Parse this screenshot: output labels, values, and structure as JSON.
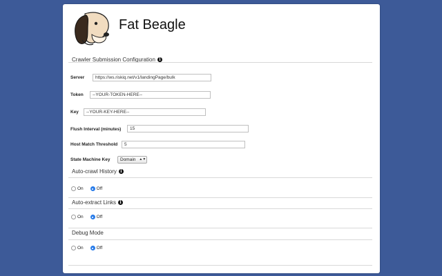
{
  "app": {
    "title": "Fat Beagle"
  },
  "crawler": {
    "legend": "Crawler Submission Configuration",
    "fields": {
      "server": {
        "label": "Server",
        "value": "https://ws.riskiq.net/v1/landingPage/bulk"
      },
      "token": {
        "label": "Token",
        "value": "--YOUR-TOKEN-HERE--"
      },
      "key": {
        "label": "Key",
        "value": "--YOUR-KEY-HERE--"
      },
      "flush_interval": {
        "label": "Flush Interval (minutes)",
        "value": "15"
      },
      "host_match": {
        "label": "Host Match Threshold",
        "value": "5"
      },
      "state_machine_key": {
        "label": "State Machine Key",
        "value": "Domain"
      }
    }
  },
  "auto_crawl": {
    "legend": "Auto-crawl History",
    "on_label": "On",
    "off_label": "Off",
    "selected": "Off"
  },
  "auto_extract": {
    "legend": "Auto-extract Links",
    "on_label": "On",
    "off_label": "Off",
    "selected": "Off"
  },
  "debug": {
    "legend": "Debug Mode",
    "on_label": "On",
    "off_label": "Off",
    "selected": "Off"
  },
  "colors": {
    "background": "#3d5a98",
    "radio_checked": "#2b7de9"
  }
}
